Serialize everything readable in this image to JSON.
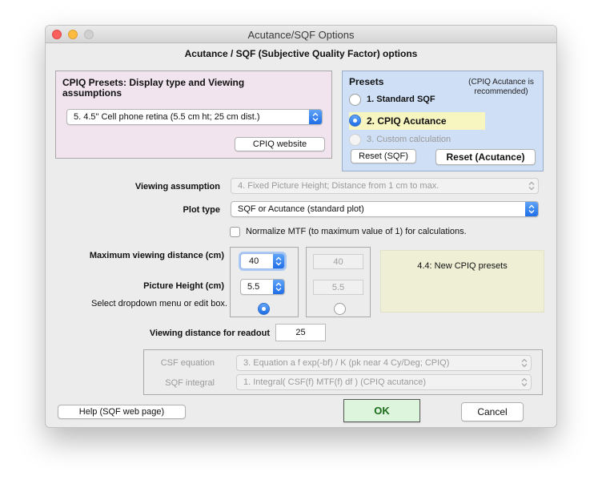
{
  "window": {
    "title": "Acutance/SQF Options"
  },
  "heading": "Acutance / SQF (Subjective Quality Factor) options",
  "cpiq": {
    "title": "CPIQ Presets:  Display type and Viewing assumptions",
    "preset_selected": "5. 4.5\" Cell phone retina (5.5 cm ht; 25 cm dist.)",
    "website_button": "CPIQ website"
  },
  "presets": {
    "title": "Presets",
    "note": "(CPIQ Acutance is recommended)",
    "options": [
      "1. Standard SQF",
      "2. CPIQ Acutance",
      "3. Custom calculation"
    ],
    "selected_index": 1,
    "reset_sqf": "Reset (SQF)",
    "reset_acutance": "Reset (Acutance)",
    "highlight_color": "#f7f5c0"
  },
  "viewing": {
    "label": "Viewing assumption",
    "value": "4. Fixed Picture Height;  Distance from 1 cm to max."
  },
  "plot": {
    "label": "Plot type",
    "value": "SQF or Acutance  (standard plot)"
  },
  "normalize": {
    "label": "Normalize MTF (to maximum value of 1) for calculations.",
    "checked": false
  },
  "distance": {
    "max_label": "Maximum viewing distance (cm)",
    "max_value": "40",
    "max_value_disabled": "40",
    "height_label": "Picture Height (cm)",
    "height_value": "5.5",
    "height_value_disabled": "5.5",
    "hint": "Select dropdown menu or edit box."
  },
  "note_box": "4.4:  New CPIQ presets",
  "readout": {
    "label": "Viewing distance for readout",
    "value": "25"
  },
  "csf": {
    "label": "CSF equation",
    "value": "3. Equation a f exp(-bf) / K        (pk near 4 Cy/Deg;  CPIQ)"
  },
  "sqf": {
    "label": "SQF integral",
    "value": "1. Integral( CSF(f) MTF(f) df )           (CPIQ acutance)"
  },
  "footer": {
    "help_button": "Help (SQF web page)",
    "ok_button": "OK",
    "cancel_button": "Cancel"
  },
  "colors": {
    "accent": "#1f6ee8",
    "cpiq_panel": "#f1e4ef",
    "presets_panel": "#cfdff5",
    "ok_button_bg": "#dcf5dc",
    "ok_text": "#1b6b1b"
  }
}
